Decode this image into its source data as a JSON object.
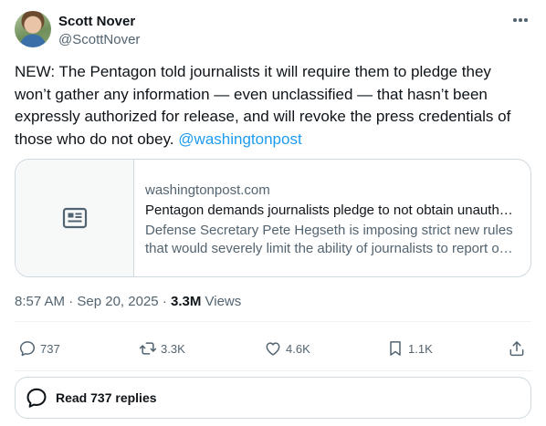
{
  "author": {
    "name": "Scott Nover",
    "handle": "@ScottNover"
  },
  "tweet": {
    "text": "NEW: The Pentagon told journalists it will require them to pledge they won’t gather any information — even unclassified — that hasn’t been expressly authorized for release, and will revoke the press credentials of those who do not obey.",
    "mention": "@washingtonpost"
  },
  "card": {
    "domain": "washingtonpost.com",
    "title": "Pentagon demands journalists pledge to not obtain unauth…",
    "description": "Defense Secretary Pete Hegseth is imposing strict new rules that would severely limit the ability of journalists to report o…",
    "icon": "news-article-icon"
  },
  "meta": {
    "time": "8:57 AM",
    "separator": "·",
    "date": "Sep 20, 2025",
    "views_count": "3.3M",
    "views_label": "Views"
  },
  "actions": {
    "reply": "737",
    "retweet": "3.3K",
    "like": "4.6K",
    "bookmark": "1.1K"
  },
  "read_replies": {
    "label": "Read 737 replies"
  },
  "colors": {
    "text": "#0f1419",
    "secondary": "#536471",
    "link": "#1d9bf0",
    "border": "#cfd9de"
  }
}
